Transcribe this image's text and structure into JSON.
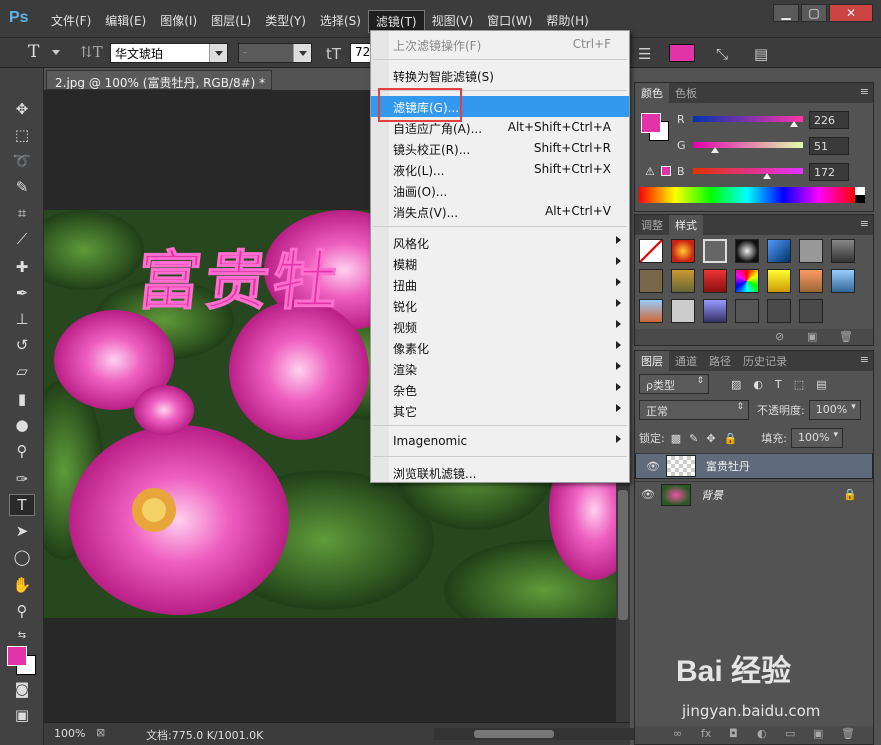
{
  "app": {
    "logo": "Ps"
  },
  "menubar": {
    "items": [
      "文件(F)",
      "编辑(E)",
      "图像(I)",
      "图层(L)",
      "类型(Y)",
      "选择(S)",
      "滤镜(T)",
      "视图(V)",
      "窗口(W)",
      "帮助(H)"
    ],
    "active_index": 6,
    "window_controls": {
      "minimize": "▁",
      "maximize": "▢",
      "close": "✕"
    }
  },
  "options_bar": {
    "font_family": "华文琥珀",
    "font_style": "-",
    "font_size": "72",
    "color_hex": "#e233a8"
  },
  "document": {
    "tab_title": "2.jpg @ 100% (富贵牡丹, RGB/8#) *",
    "tab_close": "×",
    "overlay_text": "富贵牡",
    "status_zoom": "100%",
    "status_doc": "文档:775.0 K/1001.0K"
  },
  "filter_menu": {
    "items": [
      {
        "label": "上次滤镜操作(F)",
        "shortcut": "Ctrl+F",
        "disabled": true
      },
      {
        "separator": true
      },
      {
        "label": "转换为智能滤镜(S)"
      },
      {
        "separator": true
      },
      {
        "label": "滤镜库(G)...",
        "highlighted": true
      },
      {
        "label": "自适应广角(A)...",
        "shortcut": "Alt+Shift+Ctrl+A"
      },
      {
        "label": "镜头校正(R)...",
        "shortcut": "Shift+Ctrl+R"
      },
      {
        "label": "液化(L)...",
        "shortcut": "Shift+Ctrl+X"
      },
      {
        "label": "油画(O)..."
      },
      {
        "label": "消失点(V)...",
        "shortcut": "Alt+Ctrl+V"
      },
      {
        "separator": true
      },
      {
        "label": "风格化",
        "submenu": true
      },
      {
        "label": "模糊",
        "submenu": true
      },
      {
        "label": "扭曲",
        "submenu": true
      },
      {
        "label": "锐化",
        "submenu": true
      },
      {
        "label": "视频",
        "submenu": true
      },
      {
        "label": "像素化",
        "submenu": true
      },
      {
        "label": "渲染",
        "submenu": true
      },
      {
        "label": "杂色",
        "submenu": true
      },
      {
        "label": "其它",
        "submenu": true
      },
      {
        "separator": true
      },
      {
        "label": "Imagenomic",
        "submenu": true
      },
      {
        "separator": true
      },
      {
        "label": "浏览联机滤镜..."
      }
    ]
  },
  "color_panel": {
    "tabs": [
      "颜色",
      "色板"
    ],
    "r": {
      "label": "R",
      "value": "226"
    },
    "g": {
      "label": "G",
      "value": "51"
    },
    "b": {
      "label": "B",
      "value": "172"
    }
  },
  "styles_panel": {
    "tabs": [
      "调整",
      "样式"
    ]
  },
  "layers_panel": {
    "tabs": [
      "图层",
      "通道",
      "路径",
      "历史记录"
    ],
    "filter_kind": "ρ类型",
    "blend_mode": "正常",
    "opacity_label": "不透明度:",
    "opacity_value": "100%",
    "lock_label": "锁定:",
    "fill_label": "填充:",
    "fill_value": "100%",
    "layers": [
      {
        "name": "富贵牡丹",
        "selected": true
      },
      {
        "name": "背景",
        "locked": true
      }
    ]
  },
  "watermark": {
    "logo": "Bai 经验",
    "url": "jingyan.baidu.com"
  }
}
